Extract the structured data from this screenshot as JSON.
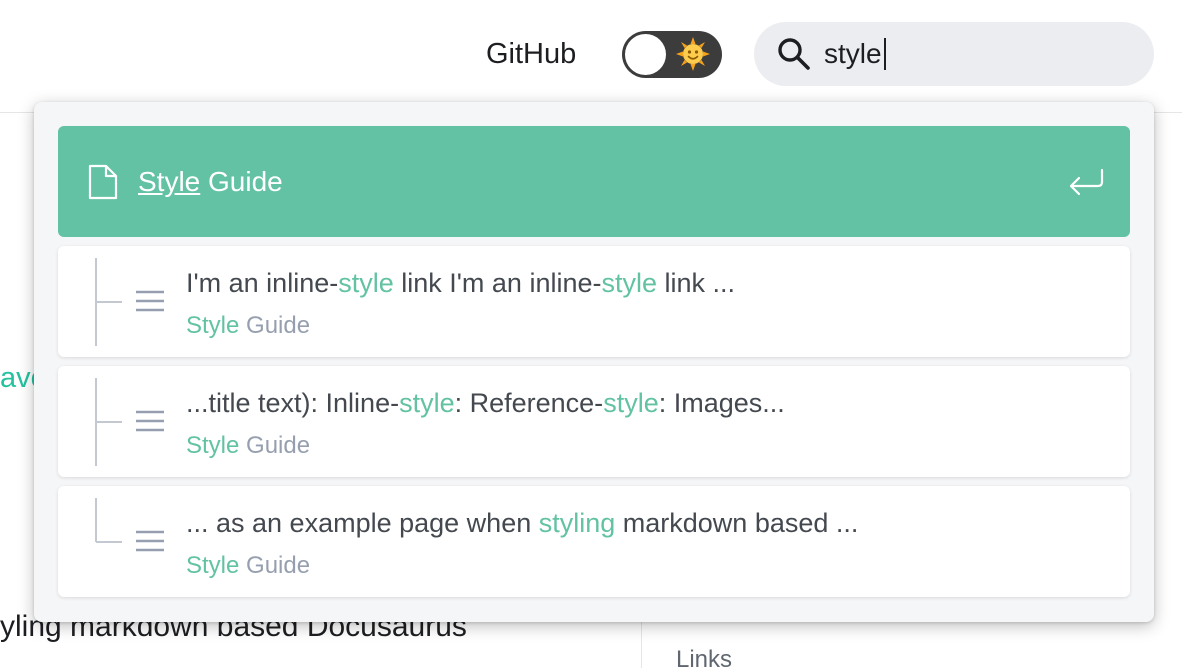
{
  "navbar": {
    "github_label": "GitHub",
    "theme_toggle_icon": "sun-emoji",
    "search": {
      "value": "style",
      "icon": "search-icon"
    }
  },
  "page": {
    "fragment_text": "avo",
    "body_text": "yling markdown based Docusaurus",
    "toc_link": "Links"
  },
  "dropdown": {
    "top_hit": {
      "title_match": "Style",
      "title_rest": " Guide",
      "icon": "document-icon",
      "action_icon": "enter-icon"
    },
    "results": [
      {
        "content_parts": [
          "I'm an inline-",
          "style",
          " link I'm an inline-",
          "style",
          " link ..."
        ],
        "path_match": "Style",
        "path_rest": " Guide"
      },
      {
        "content_parts": [
          "...title text): Inline-",
          "style",
          ": Reference-",
          "style",
          ": Images..."
        ],
        "path_match": "Style",
        "path_rest": " Guide"
      },
      {
        "content_parts": [
          "... as an example page when ",
          "styling",
          " markdown based ..."
        ],
        "path_match": "Style",
        "path_rest": " Guide"
      }
    ]
  },
  "colors": {
    "accent": "#62c2a3",
    "navbar_bg": "#ffffff",
    "search_bg": "#ebedf0",
    "dropdown_bg": "#f5f6f7",
    "toggle_bg": "#3c3c3d",
    "text": "#1c1e21",
    "muted": "#969faf"
  }
}
